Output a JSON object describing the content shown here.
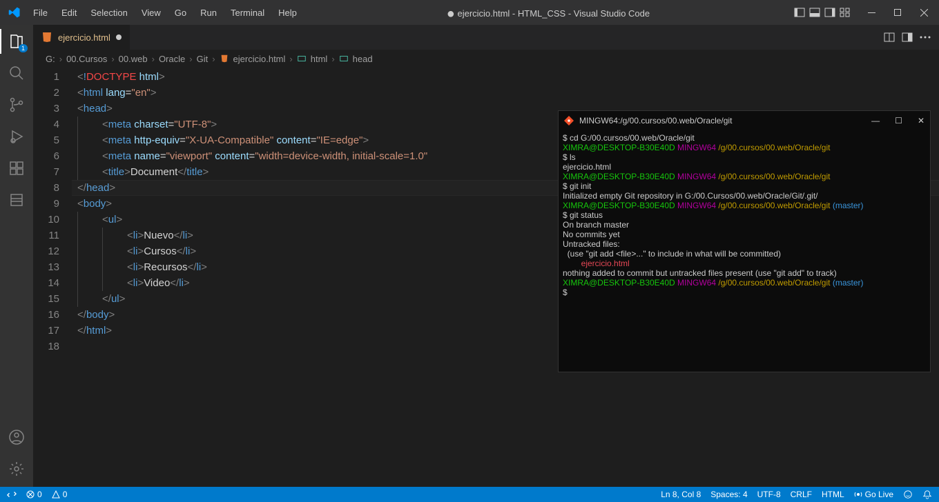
{
  "menu": [
    "File",
    "Edit",
    "Selection",
    "View",
    "Go",
    "Run",
    "Terminal",
    "Help"
  ],
  "window_title_prefix": "●",
  "window_title": "ejercicio.html - HTML_CSS - Visual Studio Code",
  "tab": {
    "filename": "ejercicio.html"
  },
  "activity_badge": "1",
  "breadcrumbs": {
    "g": "G:",
    "p1": "00.Cursos",
    "p2": "00.web",
    "p3": "Oracle",
    "p4": "Git",
    "file": "ejercicio.html",
    "sym1": "html",
    "sym2": "head"
  },
  "code_lines": [
    {
      "n": 1,
      "segs": [
        [
          "<",
          "gray"
        ],
        [
          "!",
          "blue"
        ],
        [
          "DOCTYPE",
          "red"
        ],
        [
          " ",
          "w"
        ],
        [
          "html",
          "attr"
        ],
        [
          ">",
          "gray"
        ]
      ]
    },
    {
      "n": 2,
      "segs": [
        [
          "<",
          "gray"
        ],
        [
          "html",
          "blue"
        ],
        [
          " ",
          "w"
        ],
        [
          "lang",
          "attr"
        ],
        [
          "=",
          "w"
        ],
        [
          "\"en\"",
          "str"
        ],
        [
          ">",
          "gray"
        ]
      ]
    },
    {
      "n": 3,
      "segs": [
        [
          "<",
          "gray"
        ],
        [
          "head",
          "blue"
        ],
        [
          ">",
          "gray"
        ]
      ]
    },
    {
      "n": 4,
      "indent": 1,
      "segs": [
        [
          "<",
          "gray"
        ],
        [
          "meta",
          "blue"
        ],
        [
          " ",
          "w"
        ],
        [
          "charset",
          "attr"
        ],
        [
          "=",
          "w"
        ],
        [
          "\"UTF-8\"",
          "str"
        ],
        [
          ">",
          "gray"
        ]
      ]
    },
    {
      "n": 5,
      "indent": 1,
      "segs": [
        [
          "<",
          "gray"
        ],
        [
          "meta",
          "blue"
        ],
        [
          " ",
          "w"
        ],
        [
          "http-equiv",
          "attr"
        ],
        [
          "=",
          "w"
        ],
        [
          "\"X-UA-Compatible\"",
          "str"
        ],
        [
          " ",
          "w"
        ],
        [
          "content",
          "attr"
        ],
        [
          "=",
          "w"
        ],
        [
          "\"IE=edge\"",
          "str"
        ],
        [
          ">",
          "gray"
        ]
      ]
    },
    {
      "n": 6,
      "indent": 1,
      "segs": [
        [
          "<",
          "gray"
        ],
        [
          "meta",
          "blue"
        ],
        [
          " ",
          "w"
        ],
        [
          "name",
          "attr"
        ],
        [
          "=",
          "w"
        ],
        [
          "\"viewport\"",
          "str"
        ],
        [
          " ",
          "w"
        ],
        [
          "content",
          "attr"
        ],
        [
          "=",
          "w"
        ],
        [
          "\"width=device-width, initial-scale=1.0\"",
          "str"
        ]
      ]
    },
    {
      "n": 7,
      "indent": 1,
      "segs": [
        [
          "<",
          "gray"
        ],
        [
          "title",
          "blue"
        ],
        [
          ">",
          "gray"
        ],
        [
          "Document",
          "w"
        ],
        [
          "</",
          "gray"
        ],
        [
          "title",
          "blue"
        ],
        [
          ">",
          "gray"
        ]
      ]
    },
    {
      "n": 8,
      "segs": [
        [
          "</",
          "gray"
        ],
        [
          "head",
          "blue"
        ],
        [
          ">",
          "gray"
        ]
      ],
      "active": true
    },
    {
      "n": 9,
      "segs": [
        [
          "<",
          "gray"
        ],
        [
          "body",
          "blue"
        ],
        [
          ">",
          "gray"
        ]
      ]
    },
    {
      "n": 10,
      "indent": 1,
      "segs": [
        [
          "<",
          "gray"
        ],
        [
          "ul",
          "blue"
        ],
        [
          ">",
          "gray"
        ]
      ]
    },
    {
      "n": 11,
      "indent": 2,
      "segs": [
        [
          "<",
          "gray"
        ],
        [
          "li",
          "blue"
        ],
        [
          ">",
          "gray"
        ],
        [
          "Nuevo",
          "w"
        ],
        [
          "</",
          "gray"
        ],
        [
          "li",
          "blue"
        ],
        [
          ">",
          "gray"
        ]
      ]
    },
    {
      "n": 12,
      "indent": 2,
      "segs": [
        [
          "<",
          "gray"
        ],
        [
          "li",
          "blue"
        ],
        [
          ">",
          "gray"
        ],
        [
          "Cursos",
          "w"
        ],
        [
          "</",
          "gray"
        ],
        [
          "li",
          "blue"
        ],
        [
          ">",
          "gray"
        ]
      ]
    },
    {
      "n": 13,
      "indent": 2,
      "segs": [
        [
          "<",
          "gray"
        ],
        [
          "li",
          "blue"
        ],
        [
          ">",
          "gray"
        ],
        [
          "Recursos",
          "w"
        ],
        [
          "</",
          "gray"
        ],
        [
          "li",
          "blue"
        ],
        [
          ">",
          "gray"
        ]
      ]
    },
    {
      "n": 14,
      "indent": 2,
      "segs": [
        [
          "<",
          "gray"
        ],
        [
          "li",
          "blue"
        ],
        [
          ">",
          "gray"
        ],
        [
          "Video",
          "w"
        ],
        [
          "</",
          "gray"
        ],
        [
          "li",
          "blue"
        ],
        [
          ">",
          "gray"
        ]
      ]
    },
    {
      "n": 15,
      "indent": 1,
      "segs": [
        [
          "</",
          "gray"
        ],
        [
          "ul",
          "blue"
        ],
        [
          ">",
          "gray"
        ]
      ]
    },
    {
      "n": 16,
      "segs": [
        [
          "</",
          "gray"
        ],
        [
          "body",
          "blue"
        ],
        [
          ">",
          "gray"
        ]
      ]
    },
    {
      "n": 17,
      "segs": [
        [
          "</",
          "gray"
        ],
        [
          "html",
          "blue"
        ],
        [
          ">",
          "gray"
        ]
      ]
    },
    {
      "n": 18,
      "segs": []
    }
  ],
  "terminal": {
    "title": "MINGW64:/g/00.cursos/00.web/Oracle/git",
    "lines": [
      [
        [
          "$ cd G:/00.cursos/00.web/Oracle/git",
          "w"
        ]
      ],
      [
        [
          "",
          "w"
        ]
      ],
      [
        [
          "XIMRA@DESKTOP-B30E40D",
          "green"
        ],
        [
          " ",
          "w"
        ],
        [
          "MINGW64",
          "purple"
        ],
        [
          " ",
          "w"
        ],
        [
          "/g/00.cursos/00.web/Oracle/git",
          "yellow"
        ]
      ],
      [
        [
          "$ ls",
          "w"
        ]
      ],
      [
        [
          "ejercicio.html",
          "w"
        ]
      ],
      [
        [
          "",
          "w"
        ]
      ],
      [
        [
          "XIMRA@DESKTOP-B30E40D",
          "green"
        ],
        [
          " ",
          "w"
        ],
        [
          "MINGW64",
          "purple"
        ],
        [
          " ",
          "w"
        ],
        [
          "/g/00.cursos/00.web/Oracle/git",
          "yellow"
        ]
      ],
      [
        [
          "$ git init",
          "w"
        ]
      ],
      [
        [
          "Initialized empty Git repository in G:/00.Cursos/00.web/Oracle/Git/.git/",
          "w"
        ]
      ],
      [
        [
          "",
          "w"
        ]
      ],
      [
        [
          "XIMRA@DESKTOP-B30E40D",
          "green"
        ],
        [
          " ",
          "w"
        ],
        [
          "MINGW64",
          "purple"
        ],
        [
          " ",
          "w"
        ],
        [
          "/g/00.cursos/00.web/Oracle/git",
          "yellow"
        ],
        [
          " ",
          "w"
        ],
        [
          "(master)",
          "cyan"
        ]
      ],
      [
        [
          "$ git status",
          "w"
        ]
      ],
      [
        [
          "On branch master",
          "w"
        ]
      ],
      [
        [
          "",
          "w"
        ]
      ],
      [
        [
          "No commits yet",
          "w"
        ]
      ],
      [
        [
          "",
          "w"
        ]
      ],
      [
        [
          "Untracked files:",
          "w"
        ]
      ],
      [
        [
          "  (use \"git add <file>...\" to include in what will be committed)",
          "w"
        ]
      ],
      [
        [
          "        ejercicio.html",
          "red"
        ]
      ],
      [
        [
          "",
          "w"
        ]
      ],
      [
        [
          "nothing added to commit but untracked files present (use \"git add\" to track)",
          "w"
        ]
      ],
      [
        [
          "",
          "w"
        ]
      ],
      [
        [
          "XIMRA@DESKTOP-B30E40D",
          "green"
        ],
        [
          " ",
          "w"
        ],
        [
          "MINGW64",
          "purple"
        ],
        [
          " ",
          "w"
        ],
        [
          "/g/00.cursos/00.web/Oracle/git",
          "yellow"
        ],
        [
          " ",
          "w"
        ],
        [
          "(master)",
          "cyan"
        ]
      ],
      [
        [
          "$",
          "w"
        ]
      ]
    ]
  },
  "status": {
    "errors": "0",
    "warnings": "0",
    "ln_col": "Ln 8, Col 8",
    "spaces": "Spaces: 4",
    "enc": "UTF-8",
    "eol": "CRLF",
    "lang": "HTML",
    "golive": "Go Live"
  }
}
